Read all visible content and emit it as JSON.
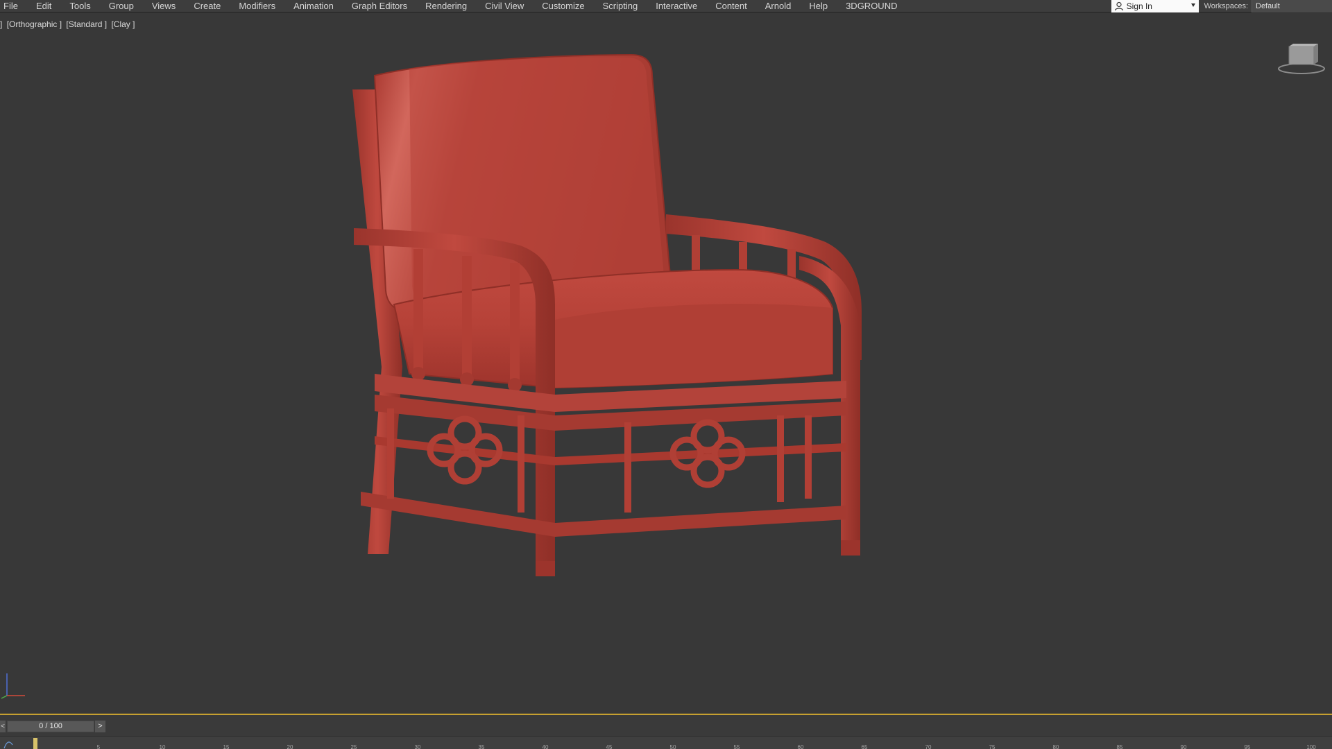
{
  "menubar": {
    "items": [
      "File",
      "Edit",
      "Tools",
      "Group",
      "Views",
      "Create",
      "Modifiers",
      "Animation",
      "Graph Editors",
      "Rendering",
      "Civil View",
      "Customize",
      "Scripting",
      "Interactive",
      "Content",
      "Arnold",
      "Help",
      "3DGROUND"
    ],
    "sign_in": "Sign In",
    "workspaces_label": "Workspaces:",
    "workspaces_value": "Default"
  },
  "viewport": {
    "labels": [
      "]",
      "[Orthographic ]",
      "[Standard ]",
      "[Clay ]"
    ],
    "model_color": "#b8453a",
    "active_border_color": "#c6a030"
  },
  "timeline": {
    "prev_label": "<",
    "slider_label": "0 / 100",
    "next_label": ">",
    "ticks": [
      "5",
      "10",
      "15",
      "20",
      "25",
      "30",
      "35",
      "40",
      "45",
      "50",
      "55",
      "60",
      "65",
      "70",
      "75",
      "80",
      "85",
      "90",
      "95",
      "100"
    ]
  },
  "icons": {
    "viewcube": "viewcube-icon",
    "axis": "axis-gizmo-icon",
    "sign_in": "user-icon",
    "dropdown": "chevron-down-icon"
  }
}
